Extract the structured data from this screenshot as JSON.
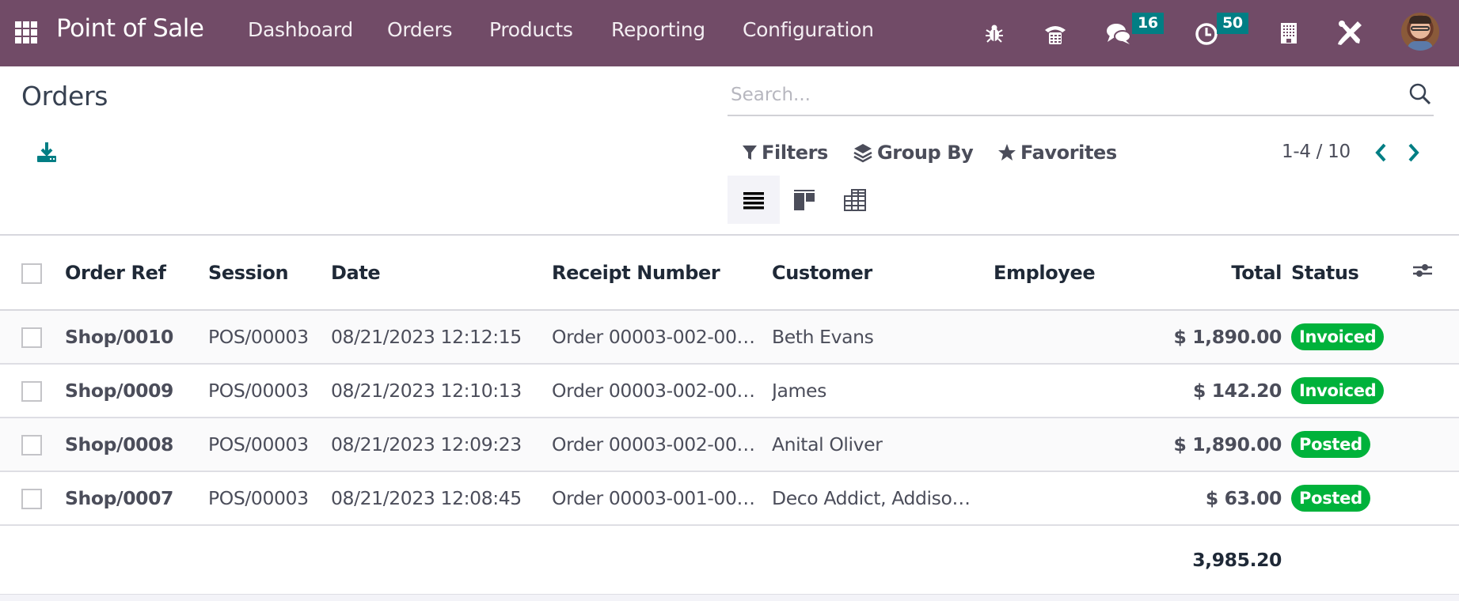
{
  "navbar": {
    "app_name": "Point of Sale",
    "menus": [
      "Dashboard",
      "Orders",
      "Products",
      "Reporting",
      "Configuration"
    ],
    "icons": {
      "debug": "bug-icon",
      "phone": "phone-icon",
      "messages": "chat-icon",
      "activities": "clock-icon",
      "company": "building-icon",
      "settings": "tools-icon"
    },
    "messages_count": "16",
    "activities_count": "50",
    "colors": {
      "background": "#714B67",
      "badge": "#017e84"
    }
  },
  "page": {
    "title": "Orders",
    "download_icon": "download-icon"
  },
  "search": {
    "placeholder": "Search...",
    "value": ""
  },
  "control_panel": {
    "filters_label": "Filters",
    "group_by_label": "Group By",
    "favorites_label": "Favorites",
    "pager": "1-4 / 10",
    "views": [
      "list",
      "kanban",
      "pivot"
    ],
    "active_view": "list"
  },
  "table": {
    "columns": [
      "Order Ref",
      "Session",
      "Date",
      "Receipt Number",
      "Customer",
      "Employee",
      "Total",
      "Status"
    ],
    "rows": [
      {
        "order_ref": "Shop/0010",
        "session": "POS/00003",
        "date": "08/21/2023 12:12:15",
        "receipt": "Order 00003-002-00…",
        "customer": "Beth Evans",
        "employee": "",
        "total": "$ 1,890.00",
        "status": "Invoiced"
      },
      {
        "order_ref": "Shop/0009",
        "session": "POS/00003",
        "date": "08/21/2023 12:10:13",
        "receipt": "Order 00003-002-00…",
        "customer": "James",
        "employee": "",
        "total": "$ 142.20",
        "status": "Invoiced"
      },
      {
        "order_ref": "Shop/0008",
        "session": "POS/00003",
        "date": "08/21/2023 12:09:23",
        "receipt": "Order 00003-002-00…",
        "customer": "Anital Oliver",
        "employee": "",
        "total": "$ 1,890.00",
        "status": "Posted"
      },
      {
        "order_ref": "Shop/0007",
        "session": "POS/00003",
        "date": "08/21/2023 12:08:45",
        "receipt": "Order 00003-001-00…",
        "customer": "Deco Addict, Addiso…",
        "employee": "",
        "total": "$ 63.00",
        "status": "Posted"
      }
    ],
    "footer_total": "3,985.20",
    "status_color": "#00b23b"
  }
}
